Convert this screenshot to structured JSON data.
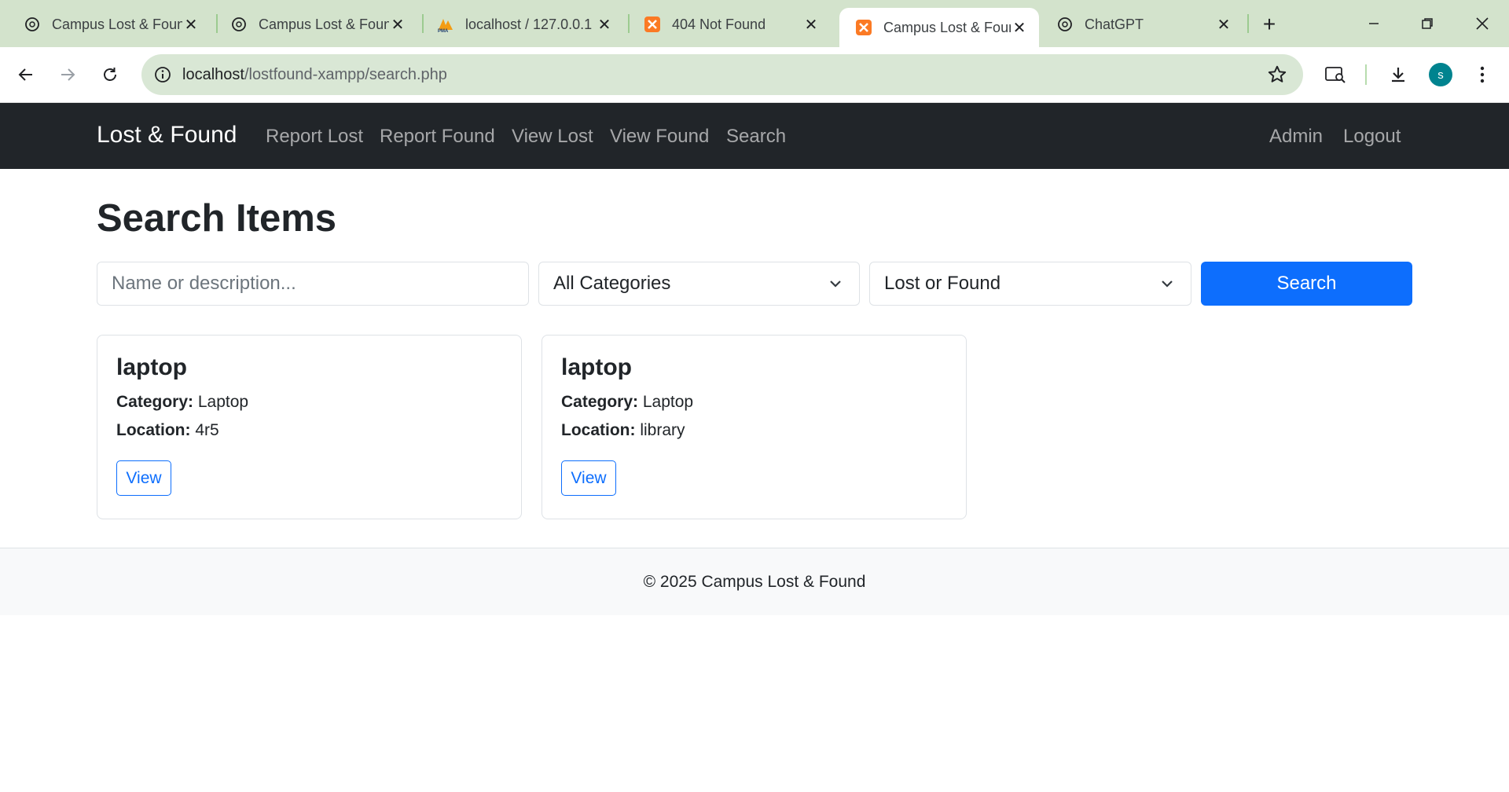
{
  "browser": {
    "tabs": [
      {
        "title": "Campus Lost & Found",
        "icon": "chatgpt-icon",
        "active": false
      },
      {
        "title": "Campus Lost & Found",
        "icon": "chatgpt-icon",
        "active": false
      },
      {
        "title": "localhost / 127.0.0.1",
        "icon": "phpmyadmin-icon",
        "active": false
      },
      {
        "title": "404 Not Found",
        "icon": "xampp-icon",
        "active": false
      },
      {
        "title": "Campus Lost & Found",
        "icon": "xampp-icon",
        "active": true
      },
      {
        "title": "ChatGPT",
        "icon": "chatgpt-icon",
        "active": false
      }
    ],
    "url_host": "localhost",
    "url_path": "/lostfound-xampp/search.php",
    "profile_initial": "s"
  },
  "navbar": {
    "brand": "Lost & Found",
    "links": [
      "Report Lost",
      "Report Found",
      "View Lost",
      "View Found",
      "Search"
    ],
    "right_links": [
      "Admin",
      "Logout"
    ]
  },
  "page": {
    "title": "Search Items",
    "search_placeholder": "Name or description...",
    "category_select": "All Categories",
    "type_select": "Lost or Found",
    "search_button": "Search"
  },
  "labels": {
    "category": "Category:",
    "location": "Location:",
    "view": "View"
  },
  "items": [
    {
      "name": "laptop",
      "category": "Laptop",
      "location": "4r5"
    },
    {
      "name": "laptop",
      "category": "Laptop",
      "location": "library"
    }
  ],
  "footer": "© 2025 Campus Lost & Found",
  "colors": {
    "navbar": "#212529",
    "primary": "#0d6efd",
    "tabstrip": "#d3e3cc"
  }
}
